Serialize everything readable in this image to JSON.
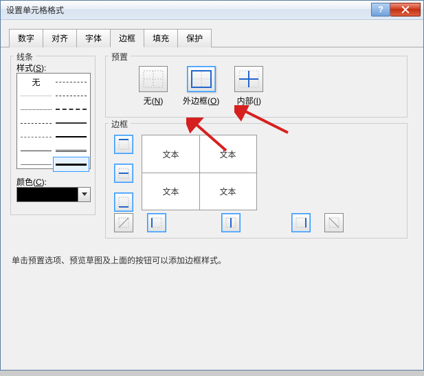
{
  "title": "设置单元格格式",
  "tabs": [
    "数字",
    "对齐",
    "字体",
    "边框",
    "填充",
    "保护"
  ],
  "active_tab": 3,
  "sections": {
    "line": "线条",
    "preset": "预置",
    "border": "边框"
  },
  "style_label_prefix": "样式(",
  "style_label_u": "S",
  "style_label_suffix": "):",
  "style_none": "无",
  "color_label_prefix": "颜色(",
  "color_label_u": "C",
  "color_label_suffix": "):",
  "presets": {
    "none": {
      "label_prefix": "无(",
      "u": "N",
      "suffix": ")"
    },
    "outline": {
      "label_prefix": "外边框(",
      "u": "O",
      "suffix": ")"
    },
    "inside": {
      "label_prefix": "内部(",
      "u": "I",
      "suffix": ")"
    }
  },
  "preview_text": "文本",
  "hint": "单击预置选项、预览草图及上面的按钮可以添加边框样式。",
  "color_value": "#000000"
}
